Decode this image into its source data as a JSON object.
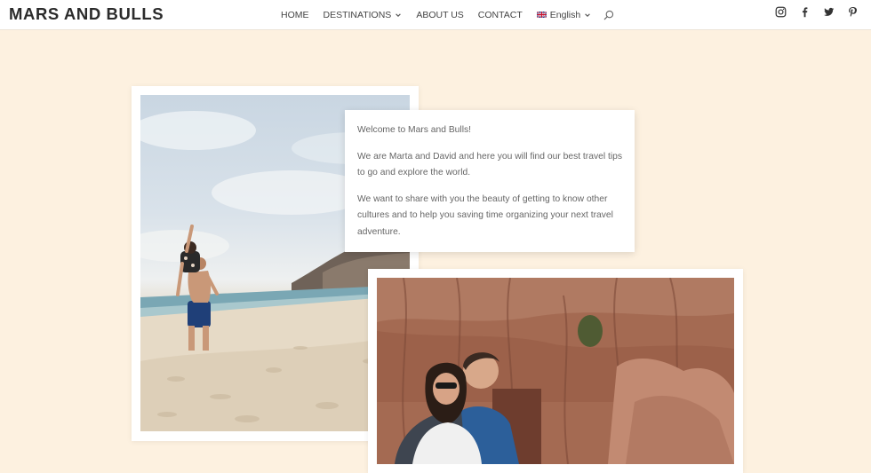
{
  "site": {
    "logo": "MARS AND BULLS"
  },
  "nav": {
    "items": [
      {
        "label": "HOME",
        "has_dropdown": false
      },
      {
        "label": "DESTINATIONS",
        "has_dropdown": true
      },
      {
        "label": "ABOUT US",
        "has_dropdown": false
      },
      {
        "label": "CONTACT",
        "has_dropdown": false
      }
    ],
    "language": {
      "label": "English",
      "flag": "uk-flag-icon",
      "has_dropdown": true
    },
    "search_icon": "search-icon"
  },
  "social": {
    "icons": [
      "instagram-icon",
      "facebook-icon",
      "twitter-icon",
      "pinterest-icon"
    ]
  },
  "intro": {
    "paragraphs": [
      "Welcome to Mars and Bulls!",
      "We are Marta and David and here you will find our best travel tips to go and explore the world.",
      "We want to share with you the beauty of getting to know other cultures and to help you saving time organizing your next travel adventure."
    ]
  },
  "photos": [
    {
      "scene": "couple on a sandy beach with a mountain in the background"
    },
    {
      "scene": "couple in front of red sandstone rock walls"
    }
  ],
  "colors": {
    "page_background": "#fdf1e0",
    "header_background": "#ffffff",
    "text": "#666666",
    "logo": "#2b2b2b"
  }
}
